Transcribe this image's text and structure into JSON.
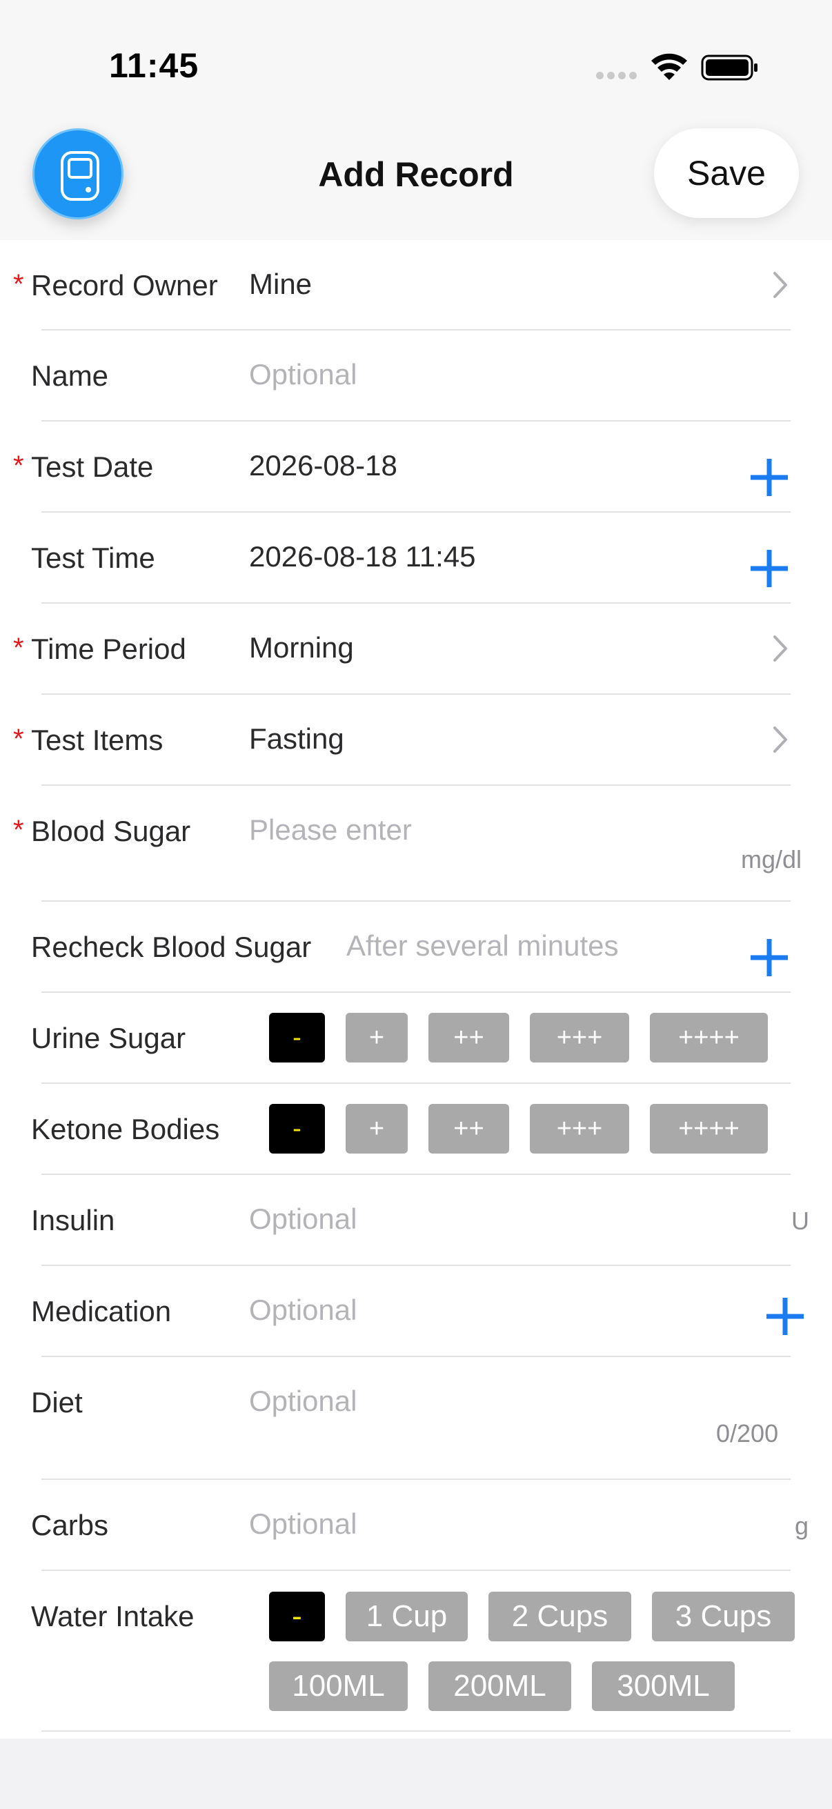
{
  "status_bar": {
    "time": "11:45"
  },
  "nav": {
    "title": "Add Record",
    "save_label": "Save",
    "app_icon": "glucose-meter-icon"
  },
  "form": {
    "record_owner": {
      "label": "Record Owner",
      "value": "Mine",
      "required": true
    },
    "name": {
      "label": "Name",
      "placeholder": "Optional"
    },
    "test_date": {
      "label": "Test Date",
      "value": "2026-08-18",
      "required": true
    },
    "test_time": {
      "label": "Test Time",
      "value": "2026-08-18 11:45"
    },
    "time_period": {
      "label": "Time Period",
      "value": "Morning",
      "required": true
    },
    "test_items": {
      "label": "Test Items",
      "value": "Fasting",
      "required": true
    },
    "blood_sugar": {
      "label": "Blood Sugar",
      "placeholder": "Please enter",
      "unit": "mg/dl",
      "required": true
    },
    "recheck": {
      "label": "Recheck Blood Sugar",
      "placeholder": "After several minutes"
    },
    "urine_sugar": {
      "label": "Urine Sugar",
      "options": [
        "-",
        "+",
        "++",
        "+++",
        "++++"
      ],
      "selected": "-"
    },
    "ketone": {
      "label": "Ketone Bodies",
      "options": [
        "-",
        "+",
        "++",
        "+++",
        "++++"
      ],
      "selected": "-"
    },
    "insulin": {
      "label": "Insulin",
      "placeholder": "Optional",
      "unit": "U"
    },
    "medication": {
      "label": "Medication",
      "placeholder": "Optional"
    },
    "diet": {
      "label": "Diet",
      "placeholder": "Optional",
      "counter": "0/200"
    },
    "carbs": {
      "label": "Carbs",
      "placeholder": "Optional",
      "unit": "g"
    },
    "water": {
      "label": "Water Intake",
      "options": [
        "-",
        "1 Cup",
        "2 Cups",
        "3 Cups",
        "100ML",
        "200ML",
        "300ML"
      ],
      "selected": "-"
    }
  },
  "colors": {
    "accent": "#1a7cf0",
    "required": "#e0191d",
    "selected_bg": "#000000",
    "selected_text": "#f2e600",
    "pill_bg": "#a9a9a9"
  }
}
